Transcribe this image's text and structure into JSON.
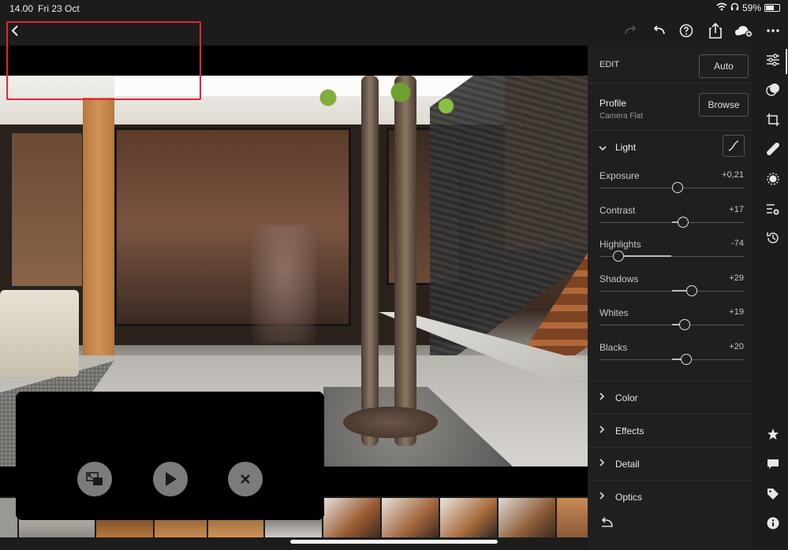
{
  "status": {
    "time": "14.00",
    "date": "Fri 23 Oct",
    "battery": "59%"
  },
  "edit": {
    "title": "EDIT",
    "auto": "Auto"
  },
  "profile": {
    "title": "Profile",
    "value": "Camera Flat",
    "browse": "Browse"
  },
  "light": {
    "title": "Light",
    "sliders": [
      {
        "name": "Exposure",
        "value": "+0,21",
        "level": 0.54
      },
      {
        "name": "Contrast",
        "value": "+17",
        "level": 0.58
      },
      {
        "name": "Highlights",
        "value": "-74",
        "level": 0.13
      },
      {
        "name": "Shadows",
        "value": "+29",
        "level": 0.64
      },
      {
        "name": "Whites",
        "value": "+19",
        "level": 0.59
      },
      {
        "name": "Blacks",
        "value": "+20",
        "level": 0.6
      }
    ]
  },
  "sections": [
    "Color",
    "Effects",
    "Detail",
    "Optics"
  ]
}
